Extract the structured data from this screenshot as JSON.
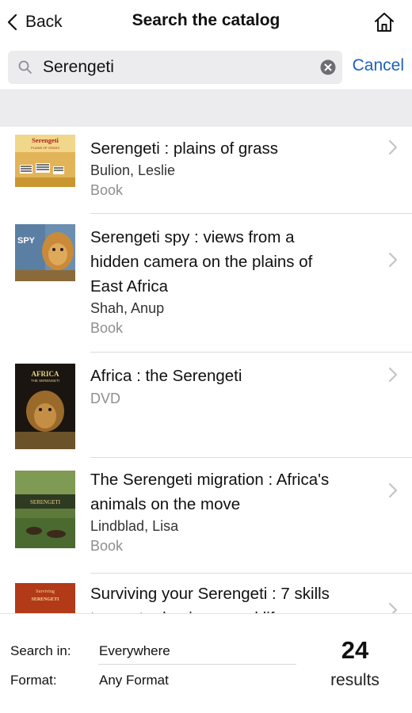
{
  "nav": {
    "back_label": "Back",
    "title": "Search the catalog",
    "home_icon": "home-icon"
  },
  "search": {
    "value": "Serengeti",
    "cancel_label": "Cancel"
  },
  "results": [
    {
      "title_lines": [
        "Serengeti : plains of grass"
      ],
      "author": "Bulion, Leslie",
      "format": "Book"
    },
    {
      "title_lines": [
        "Serengeti spy : views from a",
        "hidden camera on the plains of",
        "East Africa"
      ],
      "author": "Shah, Anup",
      "format": "Book"
    },
    {
      "title_lines": [
        "Africa : the Serengeti"
      ],
      "author": "",
      "format": "DVD"
    },
    {
      "title_lines": [
        "The Serengeti migration : Africa's",
        "animals on the move"
      ],
      "author": "Lindblad, Lisa",
      "format": "Book"
    },
    {
      "title_lines": [
        "Surviving your Serengeti : 7 skills",
        "to master business and life"
      ],
      "author": "",
      "format": ""
    }
  ],
  "covers": {
    "c1": {
      "line1": "Serengeti",
      "line2": "PLAINS OF GRASS"
    },
    "c2": {
      "badge": "SPY"
    },
    "c3": {
      "line1": "AFRICA",
      "line2": "THE SERENGETI"
    },
    "c4": {
      "band": "SERENGETI"
    },
    "c5": {
      "line1": "Surviving",
      "line2": "SERENGETI"
    }
  },
  "footer": {
    "search_in_label": "Search in:",
    "search_in_value": "Everywhere",
    "format_label": "Format:",
    "format_value": "Any Format",
    "count": "24",
    "results_label": "results"
  },
  "colors": {
    "accent": "#1f5fbf",
    "band": "#ececef"
  }
}
